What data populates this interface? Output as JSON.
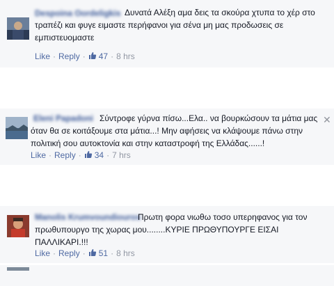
{
  "comments": [
    {
      "name": "Despoina Oordeligkis",
      "lines": [
        "Δυνατά Αλέξη αμα δεις τα σκούρα χτυπα το χέρ στο",
        "τραπέζι και φυγε ειμαστε περήφανοι για σένα μη μας προδωσεις σε",
        "εμπιστευομαστε"
      ],
      "like": "Like",
      "reply": "Reply",
      "likes": "47",
      "time": "8 hrs"
    },
    {
      "name": "Eleni Papadoni",
      "lines": [
        "Σύντροφε γύρνα πίσω...Ελα.. να βουρκώσουν τα μάτια μας",
        "όταν θα σε κοιτάξουμε στα μάτια...! Μην αφήσεις να κλάψουμε πάνω στην",
        "πολιτική σου αυτοκτονία και στην καταστροφή της Ελλάδας......!"
      ],
      "like": "Like",
      "reply": "Reply",
      "likes": "34",
      "time": "7 hrs",
      "close": "✕"
    },
    {
      "name": "Manolis Krumvoundiouros",
      "lines": [
        "Πρωτη φορα νιωθω τοσο υπερηφανος για τον",
        "πρωθυπουργο της χωρας μου........ΚΥΡΙΕ ΠΡΩΘΥΠΟΥΡΓΕ ΕΙΣΑΙ",
        "ΠΑΛΛΙΚΑΡΙ.!!!"
      ],
      "like": "Like",
      "reply": "Reply",
      "likes": "51",
      "time": "8 hrs"
    }
  ],
  "colors": {
    "link": "#4e69a2",
    "name": "#3b5998",
    "meta": "#9197a3",
    "background": "#f6f7f9"
  }
}
